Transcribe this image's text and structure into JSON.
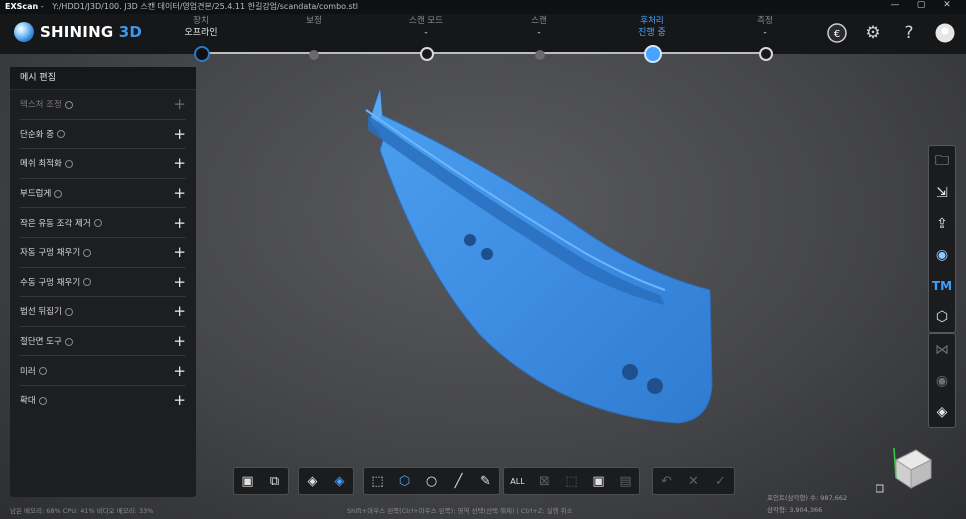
{
  "window": {
    "app": "EXScan",
    "path": "Y:/HDD1/J3D/100. J3D 스캔 데이터/영업견본/25.4.11 한길강업/scandata/combo.stl",
    "controls": [
      "—",
      "▢",
      "✕"
    ]
  },
  "brand": {
    "left": "SHINING",
    "right": " 3D"
  },
  "steps": [
    {
      "title": "장치",
      "status": "오프라인"
    },
    {
      "title": "보정",
      "status": ""
    },
    {
      "title": "스캔 모드",
      "status": "-"
    },
    {
      "title": "스캔",
      "status": "-"
    },
    {
      "title": "후처리",
      "status": "진행 중"
    },
    {
      "title": "측정",
      "status": "-"
    }
  ],
  "header_icons": [
    "language-icon",
    "gear-icon",
    "help-icon",
    "user-icon"
  ],
  "panel": {
    "title": "메시 편집",
    "items": [
      {
        "label": "텍스처 조정",
        "enabled": false
      },
      {
        "label": "단순화 중",
        "enabled": true
      },
      {
        "label": "메쉬 최적화",
        "enabled": true
      },
      {
        "label": "부드럽게",
        "enabled": true
      },
      {
        "label": "작은 유동 조각 제거",
        "enabled": true
      },
      {
        "label": "자동 구멍 채우기",
        "enabled": true
      },
      {
        "label": "수동 구멍 채우기",
        "enabled": true
      },
      {
        "label": "법선 뒤집기",
        "enabled": true
      },
      {
        "label": "절단면 도구",
        "enabled": true
      },
      {
        "label": "미러",
        "enabled": true
      },
      {
        "label": "확대",
        "enabled": true
      }
    ]
  },
  "right_toolbar_top": [
    "folder-icon",
    "import-icon",
    "export-icon",
    "globe-icon",
    "tm-icon",
    "cube-icon"
  ],
  "right_toolbar_bottom": [
    "mesh-view-icon",
    "eye-icon",
    "gem-icon"
  ],
  "status": {
    "left": "남은 메모리: 68% CPU: 41% 비디오 메모리: 33%",
    "hint": "Shift+마우스 왼쪽(Ctrl+마우스 왼쪽): 영역 선택(선택 해제) | Ctrl+Z: 실행 취소"
  },
  "stats": {
    "line1": "포인트(삼각형) 수: 987,662",
    "line2": "삼각형: 3,904,366"
  },
  "colors": {
    "accent": "#48a3ff",
    "mesh": "#3d8fe0"
  }
}
